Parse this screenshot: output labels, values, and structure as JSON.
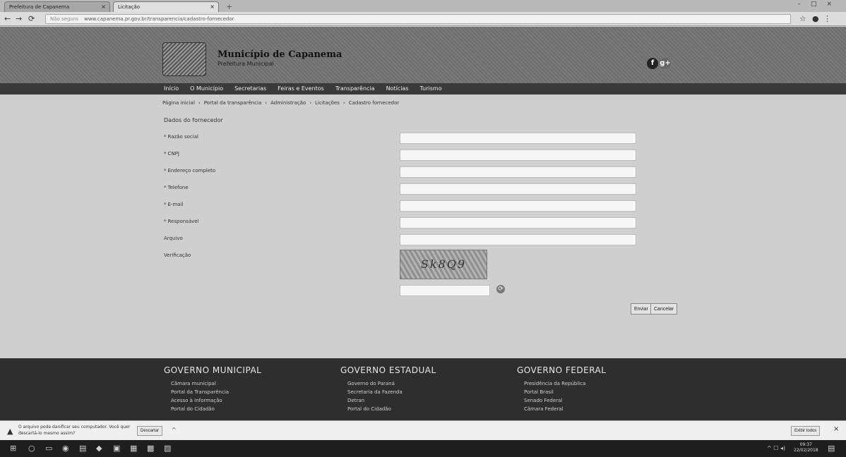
{
  "browser": {
    "tabs": [
      {
        "label": "Prefeitura de Capanema",
        "active": false
      },
      {
        "label": "Licitação",
        "active": true
      }
    ],
    "address": "www.capanema.pr.gov.br/transparencia/cadastro-fornecedor",
    "security_label": "Não seguro"
  },
  "site": {
    "title": "Município de Capanema",
    "subtitle": "Prefeitura Municipal",
    "social": [
      "f",
      "g+"
    ]
  },
  "nav": {
    "items": [
      "Início",
      "O Município",
      "Secretarias",
      "Feiras e Eventos",
      "Transparência",
      "Notícias",
      "Turismo"
    ]
  },
  "breadcrumb": [
    "Página inicial",
    "›",
    "Portal da transparência",
    "›",
    "Administração",
    "›",
    "Licitações",
    "›",
    "Cadastro fornecedor"
  ],
  "form": {
    "heading": "Dados do fornecedor",
    "labels": [
      "Razão social",
      "CNPJ",
      "Endereço completo",
      "Telefone",
      "E-mail",
      "Responsável",
      "Arquivo",
      "Verificação"
    ],
    "required_marker": "*",
    "values": [
      "",
      "",
      "",
      "",
      "",
      "",
      "",
      ""
    ],
    "captcha_text": "Sk8Q9",
    "refresh_glyph": "⟳",
    "send_label": "Enviar",
    "cancel_label": "Cancelar"
  },
  "footer": {
    "columns": [
      {
        "title": "GOVERNO MUNICIPAL",
        "links": [
          "Câmara municipal",
          "Portal da Transparência",
          "Acesso à Informação",
          "Portal do Cidadão"
        ]
      },
      {
        "title": "GOVERNO ESTADUAL",
        "links": [
          "Governo do Paraná",
          "Secretaria da Fazenda",
          "Detran",
          "Portal do Cidadão"
        ]
      },
      {
        "title": "GOVERNO FEDERAL",
        "links": [
          "Presidência da República",
          "Portal Brasil",
          "Senado Federal",
          "Câmara Federal"
        ]
      }
    ]
  },
  "download_bar": {
    "message": "O arquivo pode danificar seu computador. Você quer descartá-lo mesmo assim?",
    "discard_label": "Descartar",
    "show_all_label": "Exibir todos"
  },
  "taskbar": {
    "time": "09:37",
    "date": "22/02/2018"
  }
}
